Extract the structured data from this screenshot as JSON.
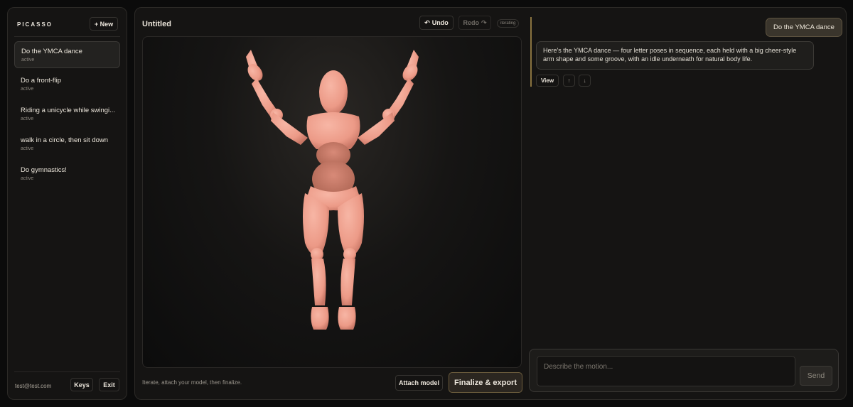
{
  "sidebar": {
    "brand": "PICASSO",
    "new_label": "+ New",
    "sessions": [
      {
        "title": "Do the YMCA dance",
        "status": "active"
      },
      {
        "title": "Do a front-flip",
        "status": "active"
      },
      {
        "title": "Riding a unicycle while swingi...",
        "status": "active"
      },
      {
        "title": "walk in a circle, then sit down",
        "status": "active"
      },
      {
        "title": "Do gymnastics!",
        "status": "active"
      }
    ],
    "user_email": "test@test.com",
    "keys_label": "Keys",
    "exit_label": "Exit"
  },
  "main": {
    "title": "Untitled",
    "undo_label": "Undo",
    "redo_label": "Redo",
    "status_badge": "iterating",
    "hint": "Iterate, attach your model, then finalize.",
    "attach_label": "Attach model",
    "finalize_label": "Finalize & export"
  },
  "chat": {
    "user_message": "Do the YMCA dance",
    "assistant_message": "Here's the YMCA dance — four letter poses in sequence, each held with a big cheer-style arm shape and some groove, with an idle underneath for natural body life.",
    "view_label": "View",
    "up_label": "↑",
    "down_label": "↓",
    "composer_placeholder": "Describe the motion...",
    "send_label": "Send"
  },
  "colors": {
    "figure": "#f0a391",
    "accent_gold": "#8a7440",
    "background": "#0b0b0b"
  }
}
